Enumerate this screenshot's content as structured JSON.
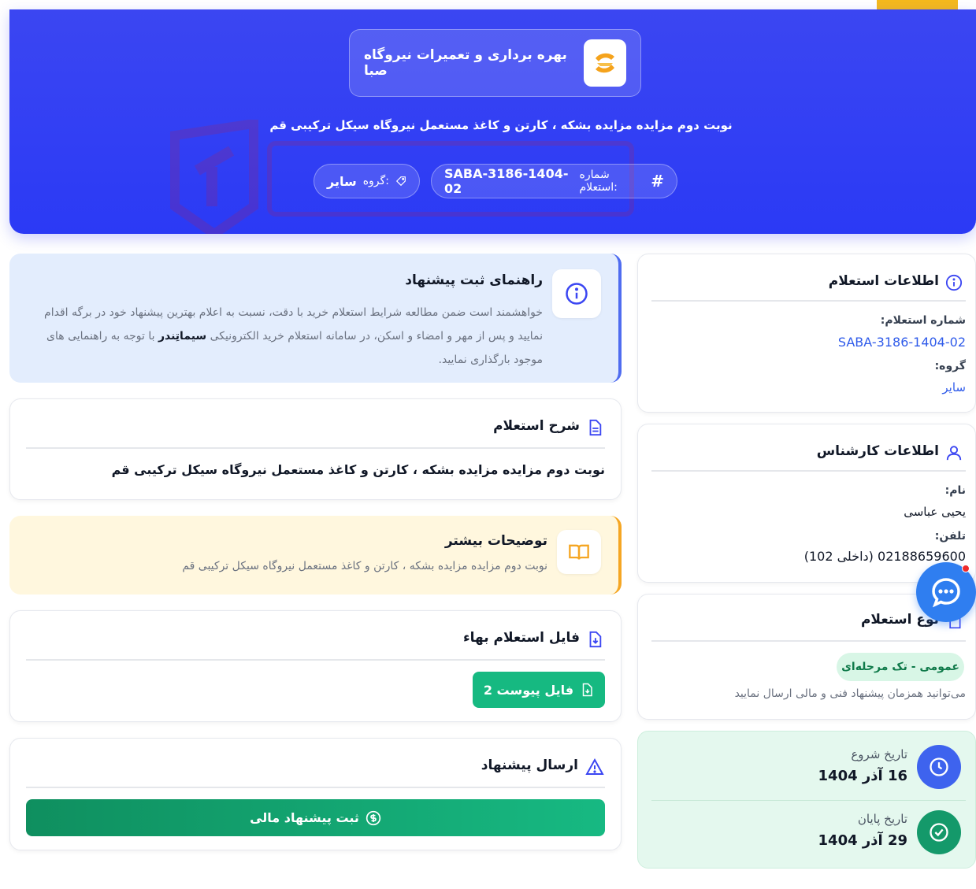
{
  "hero": {
    "org_name": "بهره برداری و تعمیرات نیروگاه صبا",
    "title": "نوبت دوم مزایده مزایده بشکه ، کارتن و کاغذ مستعمل نیروگاه سیکل ترکیبی قم",
    "inquiry_label": "شماره استعلام:",
    "inquiry_number": "SABA-3186-1404-02",
    "group_label": "گروه:",
    "group_value": "سایر"
  },
  "guide": {
    "title": "راهنمای ثبت پیشنهاد",
    "text_before": "خواهشمند است ضمن مطالعه شرایط استعلام خرید با دقت، نسبت به اعلام بهترین پیشنهاد خود در برگه اقدام نمایید و پس از مهر و امضاء و اسکن، در سامانه استعلام خرید الکترونیکی",
    "brand": "سیماتِندر",
    "text_after": "با توجه به راهنمایی های موجود بارگذاری نمایید."
  },
  "description": {
    "title": "شرح استعلام",
    "text": "نوبت دوم مزایده مزایده بشکه ، کارتن و کاغذ مستعمل نیروگاه سیکل ترکیبی قم"
  },
  "more": {
    "title": "توضیحات بیشتر",
    "text": "نوبت دوم مزایده مزایده بشکه ، کارتن و کاغذ مستعمل نیروگاه سیکل ترکیبی قم"
  },
  "file": {
    "title": "فایل استعلام بهاء",
    "button": "2 فایل پیوست"
  },
  "submit": {
    "title": "ارسال پیشنهاد",
    "button": "ثبت پیشنهاد مالی"
  },
  "inquiry_info": {
    "title": "اطلاعات استعلام",
    "number_label": "شماره استعلام:",
    "number_value": "SABA-3186-1404-02",
    "group_label": "گروه:",
    "group_value": "سایر"
  },
  "expert": {
    "title": "اطلاعات کارشناس",
    "name_label": "نام:",
    "name_value": "یحیی عباسی",
    "phone_label": "تلفن:",
    "phone_value": "02188659600 (داخلی 102)"
  },
  "type": {
    "title": "نوع استعلام",
    "badge": "عمومی - تک مرحله‌ای",
    "note": "می‌توانید همزمان پیشنهاد فنی و مالی ارسال نمایید"
  },
  "dates": {
    "start_label": "تاریخ شروع",
    "start_value": "16 آذر 1404",
    "end_label": "تاریخ پایان",
    "end_value": "29 آذر 1404"
  },
  "colors": {
    "primary": "#3b46f2",
    "green": "#16b981",
    "accent": "#f5b91c"
  }
}
